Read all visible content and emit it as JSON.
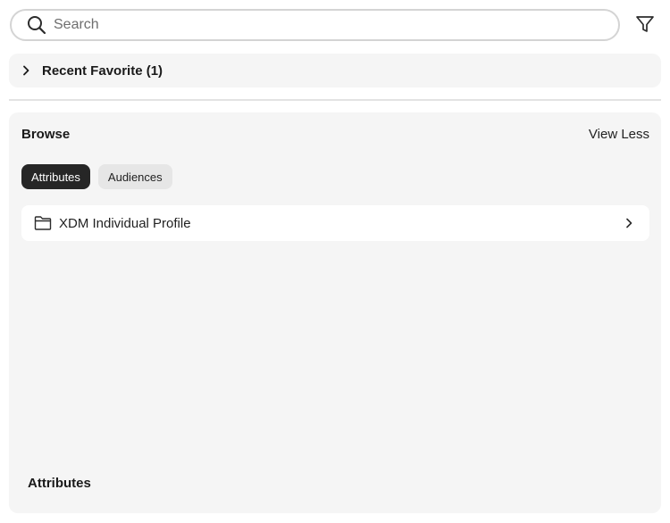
{
  "search": {
    "placeholder": "Search",
    "value": "",
    "icon": "search-icon"
  },
  "filter": {
    "icon": "filter-icon"
  },
  "recent": {
    "label": "Recent Favorite (1)",
    "expanded": false,
    "icon": "chevron-right-icon"
  },
  "browse": {
    "title": "Browse",
    "toggle_label": "View Less",
    "tabs": [
      {
        "label": "Attributes",
        "active": true
      },
      {
        "label": "Audiences",
        "active": false
      }
    ],
    "items": [
      {
        "label": "XDM Individual Profile",
        "icon": "folder-icon",
        "chevron": "chevron-right-icon"
      }
    ],
    "footer_label": "Attributes"
  },
  "colors": {
    "active_tab_bg": "#262626",
    "inactive_tab_bg": "#e6e6e6",
    "panel_bg": "#f5f5f5",
    "search_border": "#d4d4d4"
  }
}
